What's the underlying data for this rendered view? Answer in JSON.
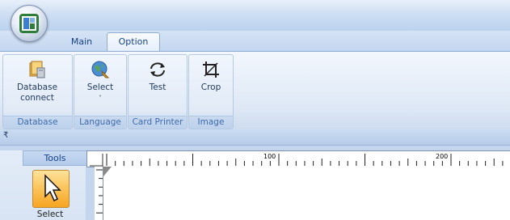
{
  "ribbon": {
    "tabs": [
      {
        "label": "Main"
      },
      {
        "label": "Option"
      }
    ],
    "groups": {
      "database": {
        "label": "Database",
        "button_line1": "Database",
        "button_line2": "connect",
        "icon": "database-connect-icon"
      },
      "language": {
        "label": "Language",
        "button": "Select",
        "dropdown_glyph": "˅",
        "icon": "globe-icon"
      },
      "card_printer": {
        "label": "Card Printer",
        "button": "Test",
        "icon": "rotate-icon"
      },
      "image": {
        "label": "Image",
        "button": "Crop",
        "icon": "crop-icon"
      }
    }
  },
  "quick_access": {
    "glyph": "₹"
  },
  "tools": {
    "header": "Tools",
    "select_label": "Select",
    "select_icon": "arrow-pointer-icon"
  },
  "ruler": {
    "label_100": "100",
    "label_200": "200"
  },
  "colors": {
    "accent_tab_text": "#15428b",
    "selected_tool": "#fbc35a",
    "ribbon_bg": "#dfe9f6"
  }
}
